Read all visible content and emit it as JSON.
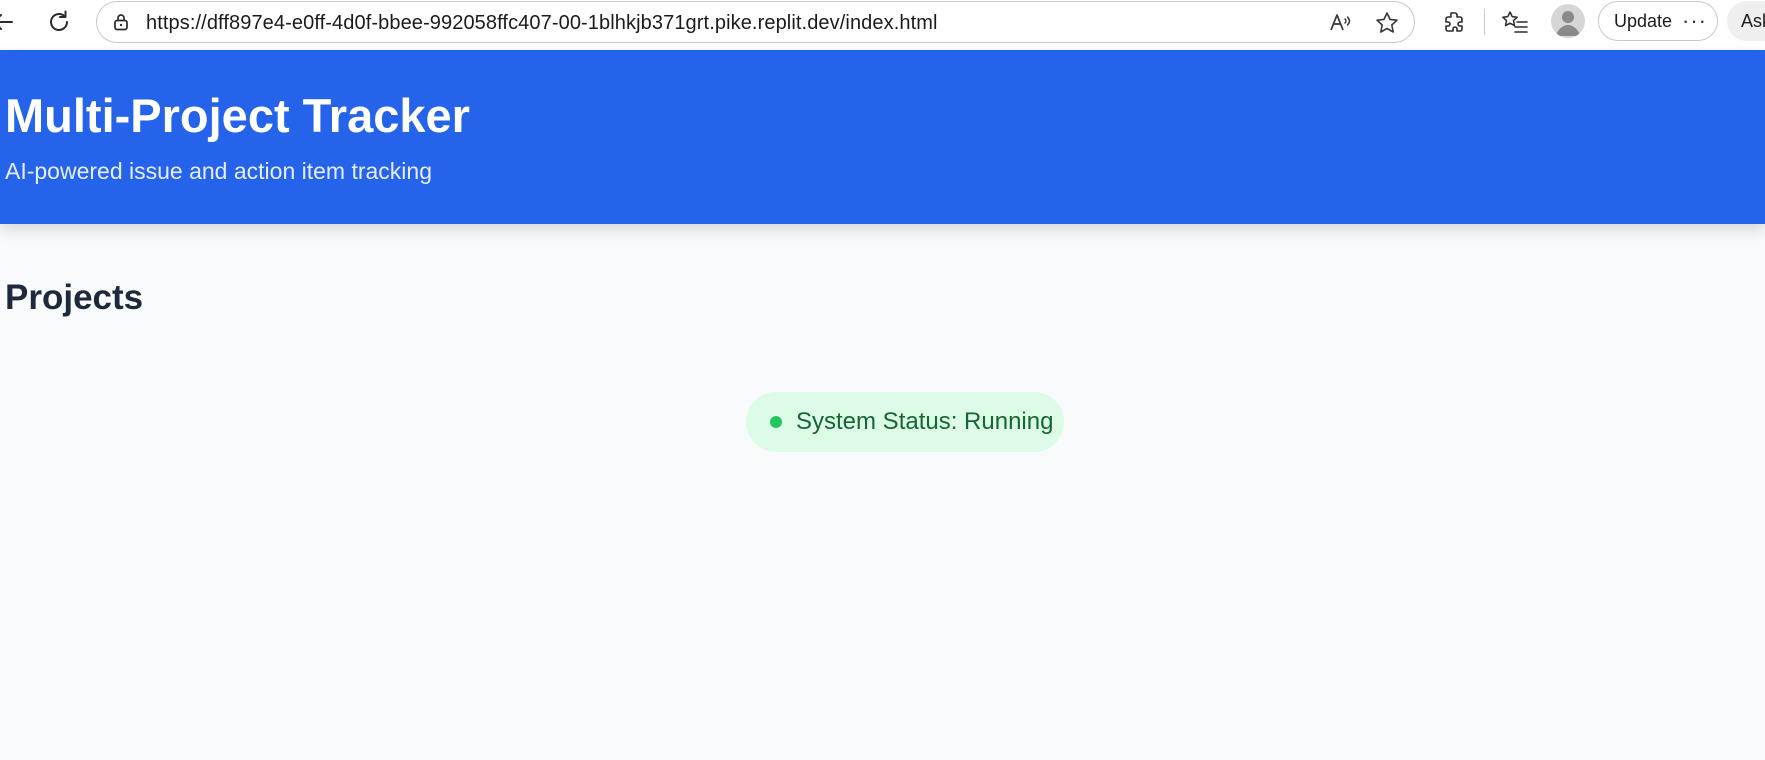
{
  "browser": {
    "url": "https://dff897e4-e0ff-4d0f-bbee-992058ffc407-00-1blhkjb371grt.pike.replit.dev/index.html",
    "update_label": "Update",
    "ask_label": "Ask",
    "icons": {
      "back": "back-arrow-icon",
      "reload": "reload-icon",
      "lock": "lock-icon",
      "read_aloud": "read-aloud-icon",
      "favorite": "star-icon",
      "extensions": "extensions-icon",
      "favorites_list": "favorites-list-icon",
      "profile": "avatar",
      "more": "more-icon"
    }
  },
  "header": {
    "title": "Multi-Project Tracker",
    "subtitle": "AI-powered issue and action item tracking",
    "background_color": "#2563eb"
  },
  "main": {
    "section_title": "Projects",
    "status": {
      "label": "System Status: Running",
      "dot_color": "#22c55e",
      "pill_color": "#dcfce7"
    }
  }
}
